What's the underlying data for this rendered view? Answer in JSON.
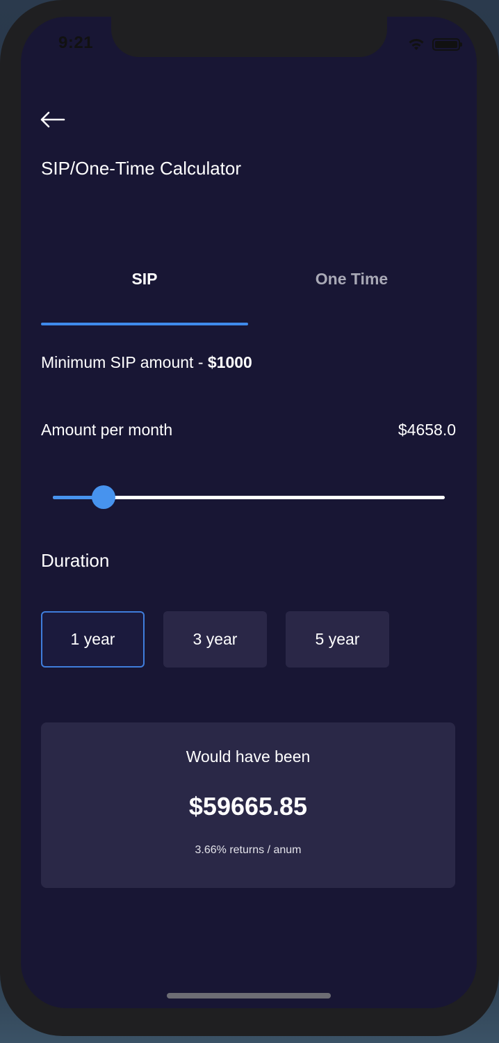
{
  "status_bar": {
    "time": "9:21"
  },
  "header": {
    "title": "SIP/One-Time Calculator"
  },
  "tabs": [
    {
      "label": "SIP",
      "active": true
    },
    {
      "label": "One Time",
      "active": false
    }
  ],
  "min_sip": {
    "prefix": "Minimum SIP amount - ",
    "amount": "$1000"
  },
  "amount": {
    "label": "Amount per month",
    "value": "$4658.0"
  },
  "slider": {
    "fraction": 0.13
  },
  "duration": {
    "label": "Duration",
    "options": [
      "1 year",
      "3 year",
      "5 year"
    ],
    "selected": "1 year"
  },
  "result": {
    "label": "Would have been",
    "amount": "$59665.85",
    "returns": "3.66% returns / anum"
  },
  "colors": {
    "background": "#181634",
    "accent": "#4793ee",
    "card": "#2a2847"
  }
}
